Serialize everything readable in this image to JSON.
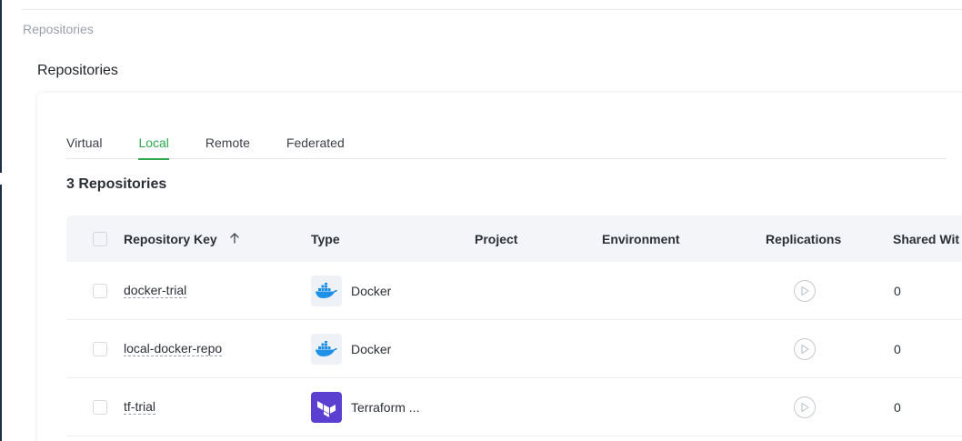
{
  "breadcrumb": "Repositories",
  "title": "Repositories",
  "tabs": [
    {
      "label": "Virtual",
      "active": false
    },
    {
      "label": "Local",
      "active": true
    },
    {
      "label": "Remote",
      "active": false
    },
    {
      "label": "Federated",
      "active": false
    }
  ],
  "repo_count": "3 Repositories",
  "columns": {
    "key": "Repository Key",
    "key_sort_icon": "arrow-up-icon",
    "type": "Type",
    "project": "Project",
    "environment": "Environment",
    "replications": "Replications",
    "shared": "Shared Wit"
  },
  "rows": [
    {
      "key": "docker-trial",
      "type": "Docker",
      "type_icon": "docker-icon",
      "project": "",
      "environment": "",
      "replications_icon": "play-icon",
      "shared": "0"
    },
    {
      "key": "local-docker-repo",
      "type": "Docker",
      "type_icon": "docker-icon",
      "project": "",
      "environment": "",
      "replications_icon": "play-icon",
      "shared": "0"
    },
    {
      "key": "tf-trial",
      "type": "Terraform ...",
      "type_icon": "terraform-icon",
      "project": "",
      "environment": "",
      "replications_icon": "play-icon",
      "shared": "0"
    }
  ],
  "colors": {
    "accent": "#2ea84f",
    "docker_blue": "#1d91e6",
    "terraform_purple": "#5b3fd0",
    "sidebar_navy": "#1d2f48"
  }
}
